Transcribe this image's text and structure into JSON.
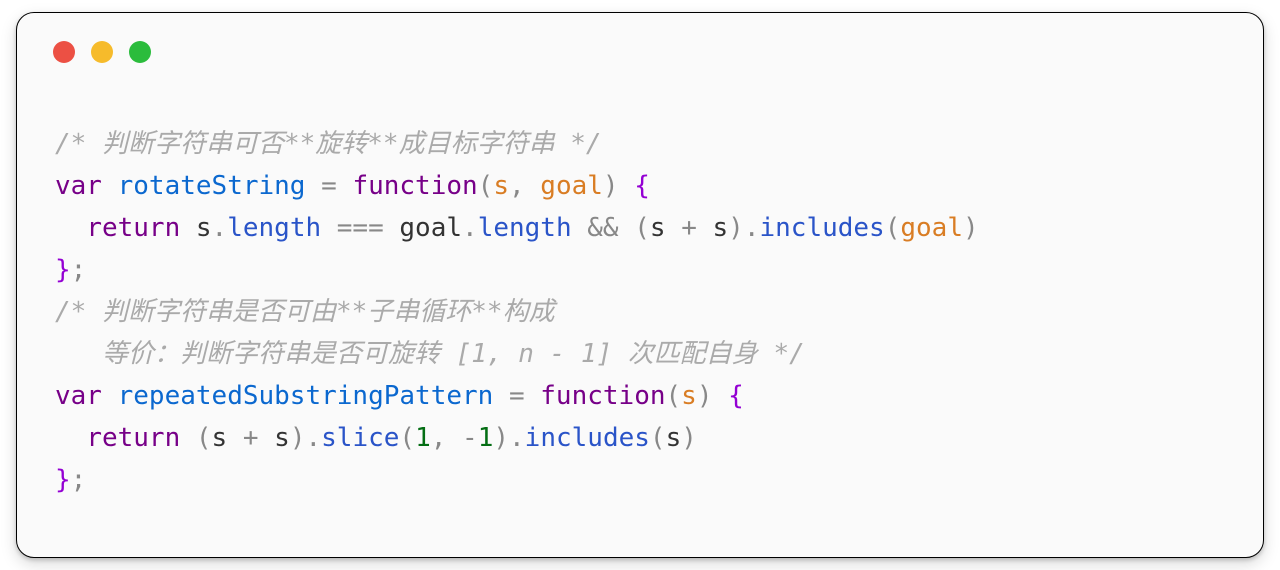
{
  "colors": {
    "background": "#fafafa",
    "border": "#000000",
    "trafficRed": "#ec5044",
    "trafficYellow": "#f6bb2b",
    "trafficGreen": "#2bbc3c",
    "comment": "#aaaaaa",
    "keyword": "#770088",
    "funcName": "#0b68cf",
    "property": "#2a54c8",
    "operator": "#888888",
    "param": "#d97d24",
    "number": "#046e14"
  },
  "code": {
    "line1": {
      "raw": "/* 判断字符串可否**旋转**成目标字符串 */"
    },
    "line2": {
      "kw_var": "var",
      "sp1": " ",
      "fn": "rotateString",
      "sp2": " ",
      "eq": "=",
      "sp3": " ",
      "kw_function": "function",
      "lp": "(",
      "p1": "s",
      "comma": ", ",
      "p2": "goal",
      "rp": ")",
      "sp4": " ",
      "lbrace": "{"
    },
    "line3": {
      "indent": "  ",
      "kw_return": "return",
      "sp1": " ",
      "id_s": "s",
      "dot1": ".",
      "prop_length1": "length",
      "sp2": " ",
      "op_eqeq": "===",
      "sp3": " ",
      "id_goal": "goal",
      "dot2": ".",
      "prop_length2": "length",
      "sp4": " ",
      "op_and": "&&",
      "sp5": " ",
      "lp": "(",
      "id_s2": "s",
      "sp6": " ",
      "op_plus": "+",
      "sp7": " ",
      "id_s3": "s",
      "rp": ")",
      "dot3": ".",
      "prop_includes": "includes",
      "lp2": "(",
      "arg_goal": "goal",
      "rp2": ")"
    },
    "line4": {
      "rbrace": "}",
      "semi": ";"
    },
    "line5": {
      "raw": "/* 判断字符串是否可由**子串循环**构成"
    },
    "line6": {
      "raw": "   等价：判断字符串是否可旋转 [1, n - 1] 次匹配自身 */"
    },
    "line7": {
      "kw_var": "var",
      "sp1": " ",
      "fn": "repeatedSubstringPattern",
      "sp2": " ",
      "eq": "=",
      "sp3": " ",
      "kw_function": "function",
      "lp": "(",
      "p1": "s",
      "rp": ")",
      "sp4": " ",
      "lbrace": "{"
    },
    "line8": {
      "indent": "  ",
      "kw_return": "return",
      "sp1": " ",
      "lp": "(",
      "id_s1": "s",
      "sp2": " ",
      "op_plus": "+",
      "sp3": " ",
      "id_s2": "s",
      "rp": ")",
      "dot1": ".",
      "prop_slice": "slice",
      "lp2": "(",
      "num1": "1",
      "comma": ", ",
      "neg": "-",
      "num2": "1",
      "rp2": ")",
      "dot2": ".",
      "prop_includes": "includes",
      "lp3": "(",
      "arg_s": "s",
      "rp3": ")"
    },
    "line9": {
      "rbrace": "}",
      "semi": ";"
    }
  }
}
